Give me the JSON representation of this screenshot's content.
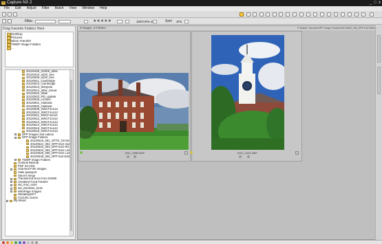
{
  "window": {
    "title": "Capture NX 2",
    "controls": [
      "_",
      "□",
      "x"
    ]
  },
  "menu": [
    "File",
    "Edit",
    "Adjust",
    "Filter",
    "Batch",
    "View",
    "Window",
    "Help"
  ],
  "filterbar": {
    "label": "Filter",
    "rating": "★★★★★",
    "pref_label": "18STAR% only",
    "sort_label": "Sort:",
    "sort_value": "JPG"
  },
  "left": {
    "favorites_header": "Drag Favorite Folders Here",
    "favorites": [
      "Desktop",
      "Pictures",
      "Nikon Transfer",
      "TWDP Image Folders",
      "..."
    ],
    "tree": [
      {
        "label": "20120405_D2300_athle",
        "indent": 3,
        "exp": false
      },
      {
        "label": "20120410_a220_tree",
        "indent": 3,
        "exp": false
      },
      {
        "label": "20120506_a220_tree",
        "indent": 3,
        "exp": false
      },
      {
        "label": "20120511_Cambridge",
        "indent": 3,
        "exp": false
      },
      {
        "label": "20120512_Cambridge",
        "indent": 3,
        "exp": false
      },
      {
        "label": "20120513_Wimpole",
        "indent": 3,
        "exp": false
      },
      {
        "label": "20120514_athle_bread",
        "indent": 3,
        "exp": false
      },
      {
        "label": "20120522_Walk",
        "indent": 3,
        "exp": false
      },
      {
        "label": "20120523_RD_update",
        "indent": 3,
        "exp": false
      },
      {
        "label": "20120526_London",
        "indent": 3,
        "exp": false
      },
      {
        "label": "20120601_Harlland",
        "indent": 3,
        "exp": false
      },
      {
        "label": "20120602_Harlland",
        "indent": 3,
        "exp": false
      },
      {
        "label": "20120608_SWCFJun12",
        "indent": 3,
        "exp": false
      },
      {
        "label": "20120610_SWCFJun12",
        "indent": 3,
        "exp": false
      },
      {
        "label": "20120611_SWCFJun12",
        "indent": 3,
        "exp": false
      },
      {
        "label": "20120612_SWCFJun12",
        "indent": 3,
        "exp": false
      },
      {
        "label": "20120613_SWCFJun12",
        "indent": 3,
        "exp": false
      },
      {
        "label": "20120614_SWCFJun12",
        "indent": 3,
        "exp": false
      },
      {
        "label": "20120615_SWCFJun12",
        "indent": 3,
        "exp": false
      },
      {
        "label": "20120616_SWCFJun12",
        "indent": 3,
        "exp": false
      },
      {
        "label": "DPP Images and videos",
        "indent": 2,
        "exp": true
      },
      {
        "label": "DPP Image Folders",
        "indent": 2,
        "exp": true
      },
      {
        "label": "20120616_001_SFTN_Orchester",
        "indent": 4,
        "exp": false
      },
      {
        "label": "20120621_002_DPP EoS Hangar",
        "indent": 4,
        "exp": false
      },
      {
        "label": "20120622_003_DPP EoS Rft.2 ba",
        "indent": 4,
        "exp": false
      },
      {
        "label": "20120624_004_DPP EoS Low Cor",
        "indent": 4,
        "exp": false
      },
      {
        "label": "20120626_005_DPP EoS Low Cor",
        "indent": 4,
        "exp": false
      },
      {
        "label": "20120629_006_DPP Exif Editing",
        "indent": 4,
        "exp": false
      },
      {
        "label": "TWDP Image Folders",
        "indent": 2,
        "exp": true
      },
      {
        "label": "Outlook Backup",
        "indent": 1,
        "exp": false
      },
      {
        "label": "PDF SCANS",
        "indent": 1,
        "exp": false
      },
      {
        "label": "Scanned Film Images",
        "indent": 1,
        "exp": true
      },
      {
        "label": "Slide passport",
        "indent": 1,
        "exp": false
      },
      {
        "label": "Steve's Ninja",
        "indent": 1,
        "exp": false
      },
      {
        "label": "Transferred Docs from Dell05",
        "indent": 1,
        "exp": true
      },
      {
        "label": "Unedited Food Folders",
        "indent": 1,
        "exp": true
      },
      {
        "label": "wd_mac_tools",
        "indent": 1,
        "exp": true
      },
      {
        "label": "wd_windows_tools",
        "indent": 1,
        "exp": true
      },
      {
        "label": "WebPage Images",
        "indent": 1,
        "exp": true
      },
      {
        "label": "Wedding1977",
        "indent": 1,
        "exp": false
      },
      {
        "label": "X12USL Scans",
        "indent": 1,
        "exp": false
      },
      {
        "label": "My Music",
        "indent": 0,
        "exp": true
      }
    ]
  },
  "browser": {
    "count_text": "0 images, 2 Folders",
    "path_text": "F:\\Master Transfer\\DPP Image Folders\\20120629_006_DPP Exif Editing",
    "thumbs": [
      {
        "caption": "DSC_0960.NEF"
      },
      {
        "caption": "DSC_1231.NEF"
      }
    ]
  },
  "colors": {
    "selected_tool": "#ffcc33",
    "titlebar": "#1c1c1c",
    "panel": "#efefef"
  },
  "status_labels": [
    "1",
    "2",
    "3",
    "4",
    "5",
    "6",
    "7",
    "8",
    "9"
  ]
}
